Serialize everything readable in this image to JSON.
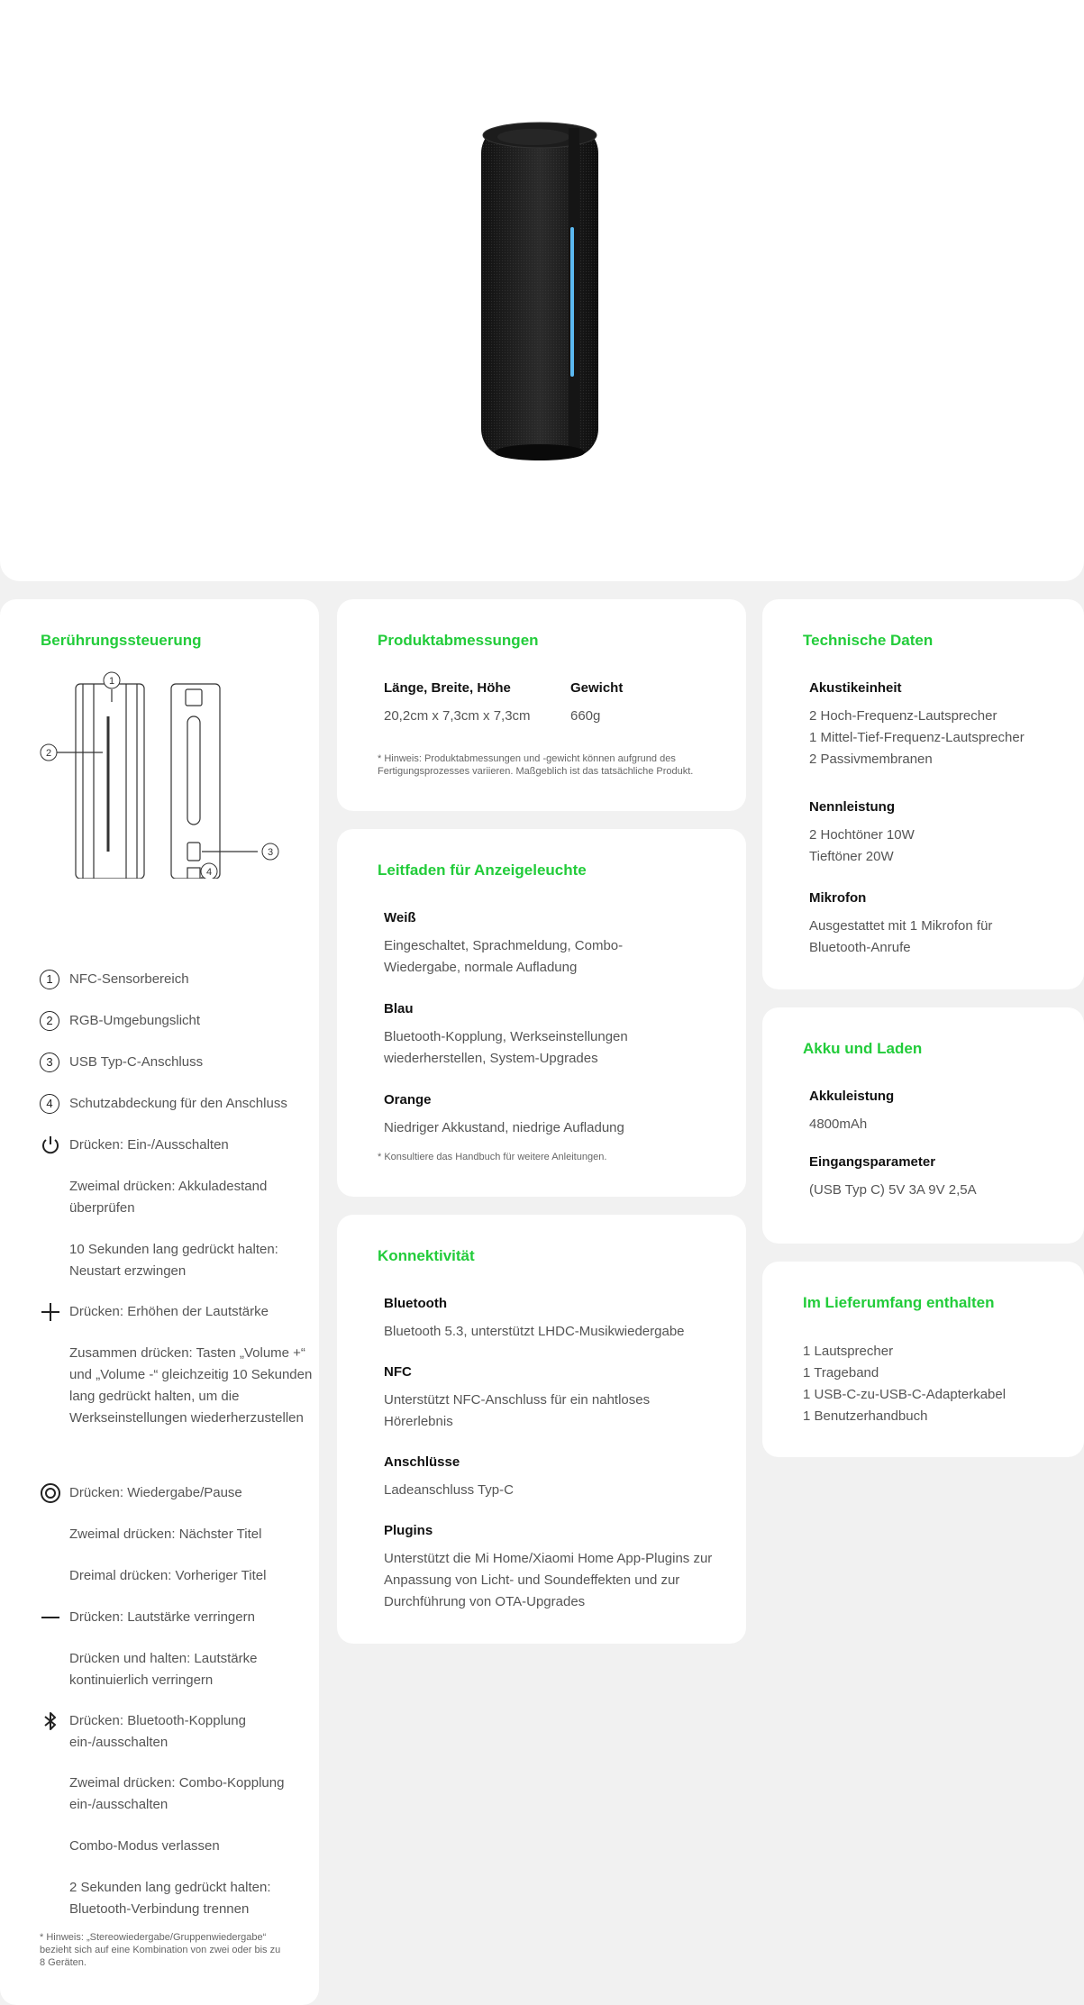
{
  "touch": {
    "title": "Berührungssteuerung",
    "diagram_labels": [
      "1",
      "2",
      "3",
      "4"
    ],
    "numbered": [
      {
        "num": "1",
        "text": "NFC-Sensorbereich"
      },
      {
        "num": "2",
        "text": "RGB-Umgebungslicht"
      },
      {
        "num": "3",
        "text": "USB Typ-C-Anschluss"
      },
      {
        "num": "4",
        "text": "Schutzabdeckung für den Anschluss"
      }
    ],
    "power": [
      "Drücken: Ein-/Ausschalten",
      "Zweimal drücken: Akkuladestand überprüfen",
      "10 Sekunden lang gedrückt halten: Neustart erzwingen"
    ],
    "volume_up": [
      "Drücken: Erhöhen der Lautstärke",
      "Zusammen drücken: Tasten „Volume +“ und „Volume -“ gleichzeitig 10 Sekunden lang gedrückt halten, um die Werkseinstellungen wiederherzustellen"
    ],
    "play": [
      "Drücken: Wiedergabe/Pause",
      "Zweimal drücken: Nächster Titel",
      "Dreimal drücken: Vorheriger Titel"
    ],
    "volume_down": [
      "Drücken: Lautstärke verringern",
      "Drücken und halten: Lautstärke kontinuierlich verringern"
    ],
    "bluetooth": [
      "Drücken: Bluetooth-Kopplung ein-/ausschalten",
      "Zweimal drücken: Combo-Kopplung ein-/ausschalten",
      "Combo-Modus verlassen",
      "2 Sekunden lang gedrückt halten: Bluetooth-Verbindung trennen"
    ],
    "note": "* Hinweis: „Stereowiedergabe/Gruppenwiedergabe“ bezieht sich auf eine Kombination von zwei oder bis zu 8 Geräten."
  },
  "dimensions": {
    "title": "Produktabmessungen",
    "size_label": "Länge, Breite, Höhe",
    "size_value": "20,2cm x 7,3cm x 7,3cm",
    "weight_label": "Gewicht",
    "weight_value": "660g",
    "note": "* Hinweis: Produktabmessungen und -gewicht können aufgrund des Fertigungsprozesses variieren. Maßgeblich ist das tatsächliche Produkt."
  },
  "indicator": {
    "title": "Leitfaden für Anzeigeleuchte",
    "items": [
      {
        "label": "Weiß",
        "text": "Eingeschaltet, Sprachmeldung, Combo-Wiedergabe, normale Aufladung"
      },
      {
        "label": "Blau",
        "text": "Bluetooth-Kopplung, Werkseinstellungen wiederherstellen, System-Upgrades"
      },
      {
        "label": "Orange",
        "text": "Niedriger Akkustand, niedrige Aufladung"
      }
    ],
    "note": "* Konsultiere das Handbuch für weitere Anleitungen."
  },
  "connectivity": {
    "title": "Konnektivität",
    "items": [
      {
        "label": "Bluetooth",
        "text": "Bluetooth 5.3, unterstützt LHDC-Musikwiedergabe"
      },
      {
        "label": "NFC",
        "text": "Unterstützt NFC-Anschluss für ein nahtloses Hörerlebnis"
      },
      {
        "label": "Anschlüsse",
        "text": "Ladeanschluss Typ-C"
      },
      {
        "label": "Plugins",
        "text": "Unterstützt die Mi Home/Xiaomi Home App-Plugins zur Anpassung von Licht- und Soundeffekten und zur Durchführung von OTA-Upgrades"
      }
    ]
  },
  "specs": {
    "title": "Technische Daten",
    "items": [
      {
        "label": "Akustikeinheit",
        "lines": [
          "2 Hoch-Frequenz-Lautsprecher",
          "1 Mittel-Tief-Frequenz-Lautsprecher",
          "2 Passivmembranen"
        ]
      },
      {
        "label": "Nennleistung",
        "lines": [
          "2 Hochtöner 10W",
          "Tieftöner 20W"
        ]
      },
      {
        "label": "Mikrofon",
        "lines": [
          "Ausgestattet mit 1 Mikrofon für",
          "Bluetooth-Anrufe"
        ]
      }
    ]
  },
  "battery": {
    "title": "Akku und Laden",
    "items": [
      {
        "label": "Akkuleistung",
        "text": "4800mAh"
      },
      {
        "label": "Eingangsparameter",
        "text": "(USB Typ C) 5V 3A 9V 2,5A"
      }
    ]
  },
  "box": {
    "title": "Im Lieferumfang enthalten",
    "lines": [
      "1 Lautsprecher",
      "1 Trageband",
      "1 USB-C-zu-USB-C-Adapterkabel",
      "1 Benutzerhandbuch"
    ]
  },
  "colors": {
    "accent": "#22cc3a",
    "led": "#5bb8f0"
  }
}
